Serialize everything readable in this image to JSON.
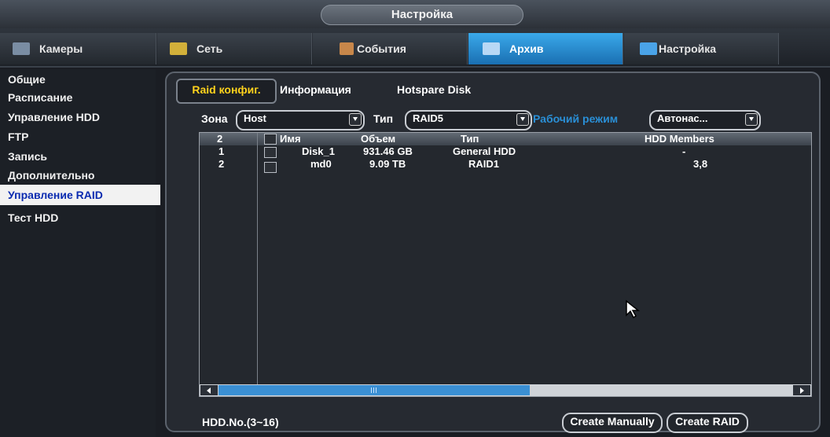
{
  "window": {
    "title": "Настройка"
  },
  "top_tabs": [
    {
      "label": "Камеры",
      "icon": "camera-icon"
    },
    {
      "label": "Сеть",
      "icon": "network-icon"
    },
    {
      "label": "События",
      "icon": "events-icon"
    },
    {
      "label": "Архив",
      "icon": "archive-icon",
      "active": true
    },
    {
      "label": "Настройка",
      "icon": "settings-icon"
    }
  ],
  "sidebar": {
    "items": [
      {
        "label": "Общие"
      },
      {
        "label": "Расписание"
      },
      {
        "label": "Управление HDD"
      },
      {
        "label": "FTP"
      },
      {
        "label": "Запись"
      },
      {
        "label": "Дополнительно"
      },
      {
        "label": "Управление RAID",
        "active": true
      },
      {
        "label": "Тест HDD"
      }
    ]
  },
  "subtabs": [
    {
      "label": "Raid конфиг.",
      "active": true
    },
    {
      "label": "Информация"
    },
    {
      "label": "Hotspare Disk"
    }
  ],
  "filters": {
    "zone_label": "Зона",
    "zone_value": "Host",
    "type_label": "Тип",
    "type_value": "RAID5",
    "mode_label": "Рабочий режим",
    "mode_value": "Автонас..."
  },
  "table": {
    "columns": [
      "2",
      "",
      "Имя",
      "Объем",
      "Тип",
      "HDD Members"
    ],
    "rows": [
      {
        "num": "1",
        "name": "Disk_1",
        "size": "931.46 GB",
        "type": "General HDD",
        "members": "-"
      },
      {
        "num": "2",
        "name": "md0",
        "size": "9.09 TB",
        "type": "RAID1",
        "members": "3,8"
      }
    ]
  },
  "footer": {
    "hdd_no": "HDD.No.(3~16)",
    "create_manually": "Create Manually",
    "create_raid": "Create RAID"
  },
  "colors": {
    "accent_blue": "#2a8fd6",
    "active_tab_text": "#ffd21c",
    "sidebar_active_text": "#0b2bb0"
  }
}
